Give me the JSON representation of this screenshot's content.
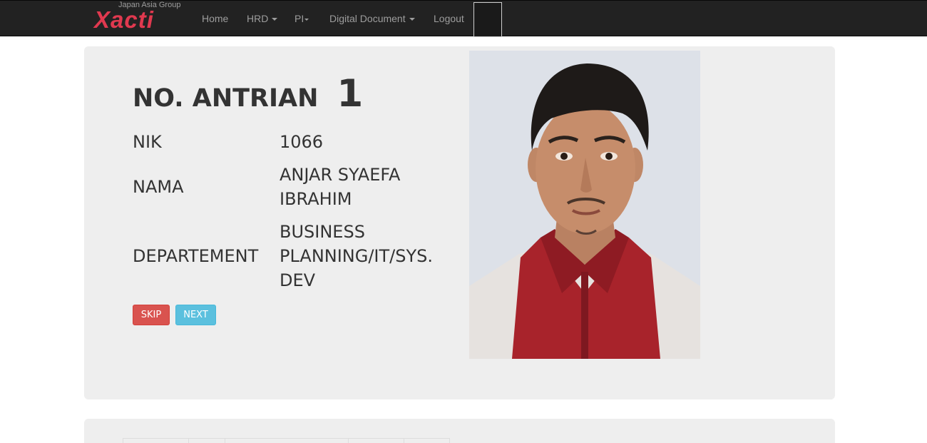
{
  "navbar": {
    "brand_sub": "Japan Asia Group",
    "brand_name": "Xacti",
    "items": [
      {
        "label": "Home",
        "dropdown": false
      },
      {
        "label": "HRD",
        "dropdown": true
      },
      {
        "label": "PI",
        "dropdown": true
      },
      {
        "label": "Digital Document",
        "dropdown": true
      },
      {
        "label": "Logout",
        "dropdown": false
      }
    ]
  },
  "queue": {
    "label": "NO. ANTRIAN",
    "number": "1"
  },
  "employee": {
    "nik_label": "NIK",
    "nik_value": "1066",
    "nama_label": "NAMA",
    "nama_value": "ANJAR SYAEFA IBRAHIM",
    "dept_label": "DEPARTEMENT",
    "dept_value": "BUSINESS PLANNING/IT/SYS. DEV"
  },
  "actions": {
    "skip_label": "SKIP",
    "next_label": "NEXT"
  },
  "colors": {
    "navbar_bg": "#222222",
    "brand": "#e0394f",
    "skip": "#d9534f",
    "next": "#5bc0de",
    "panel_bg": "#eeeeee"
  }
}
